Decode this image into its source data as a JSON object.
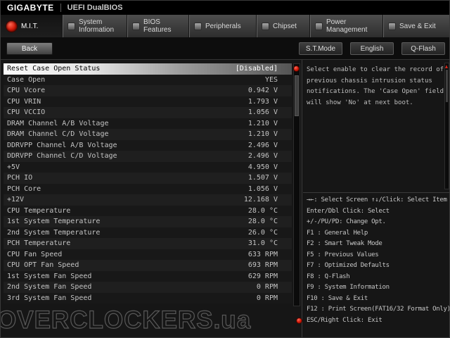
{
  "header": {
    "brand": "GIGABYTE",
    "title": "UEFI DualBIOS"
  },
  "tabs": [
    {
      "label": "M.I.T.",
      "icon": "mit-fan-icon",
      "active": true
    },
    {
      "label": "System Information",
      "icon": "system-information-icon",
      "active": false
    },
    {
      "label": "BIOS Features",
      "icon": "bios-features-icon",
      "active": false
    },
    {
      "label": "Peripherals",
      "icon": "peripherals-icon",
      "active": false
    },
    {
      "label": "Chipset",
      "icon": "chipset-icon",
      "active": false
    },
    {
      "label": "Power Management",
      "icon": "power-management-icon",
      "active": false
    },
    {
      "label": "Save & Exit",
      "icon": "save-exit-icon",
      "active": false
    }
  ],
  "toolbar": {
    "back": "Back",
    "buttons": [
      "S.T.Mode",
      "English",
      "Q-Flash"
    ]
  },
  "settings": [
    {
      "label": "Reset Case Open Status",
      "value": "[Disabled]",
      "selected": true
    },
    {
      "label": "Case Open",
      "value": "YES"
    },
    {
      "label": "CPU Vcore",
      "value": "0.942 V"
    },
    {
      "label": "CPU VRIN",
      "value": "1.793 V"
    },
    {
      "label": "CPU VCCIO",
      "value": "1.056 V"
    },
    {
      "label": "DRAM Channel A/B Voltage",
      "value": "1.210 V"
    },
    {
      "label": "DRAM Channel C/D Voltage",
      "value": "1.210 V"
    },
    {
      "label": "DDRVPP Channel A/B Voltage",
      "value": "2.496 V"
    },
    {
      "label": "DDRVPP Channel C/D Voltage",
      "value": "2.496 V"
    },
    {
      "label": "+5V",
      "value": "4.950 V"
    },
    {
      "label": "PCH IO",
      "value": "1.507 V"
    },
    {
      "label": "PCH Core",
      "value": "1.056 V"
    },
    {
      "label": "+12V",
      "value": "12.168 V"
    },
    {
      "label": "CPU Temperature",
      "value": "28.0 °C"
    },
    {
      "label": "1st System Temperature",
      "value": "28.0 °C"
    },
    {
      "label": "2nd System Temperature",
      "value": "26.0 °C"
    },
    {
      "label": "PCH Temperature",
      "value": "31.0 °C"
    },
    {
      "label": "CPU Fan Speed",
      "value": "633 RPM"
    },
    {
      "label": "CPU OPT Fan Speed",
      "value": "693 RPM"
    },
    {
      "label": "1st System Fan Speed",
      "value": "629 RPM"
    },
    {
      "label": "2nd System Fan Speed",
      "value": "0 RPM"
    },
    {
      "label": "3rd System Fan Speed",
      "value": "0 RPM"
    }
  ],
  "help": {
    "text": "Select enable to clear the record of previous chassis intrusion status notifications. The 'Case Open' field will show 'No' at next boot."
  },
  "keyhelp": [
    "→←: Select Screen  ↑↓/Click: Select Item",
    "Enter/Dbl Click: Select",
    "+/-/PU/PD: Change Opt.",
    "F1  : General Help",
    "F2  : Smart Tweak Mode",
    "F5  : Previous Values",
    "F7  : Optimized Defaults",
    "F8  : Q-Flash",
    "F9  : System Information",
    "F10 : Save & Exit",
    "F12 : Print Screen(FAT16/32 Format Only)",
    "ESC/Right Click: Exit"
  ],
  "watermark": "OVERCLOCKERS.ua"
}
